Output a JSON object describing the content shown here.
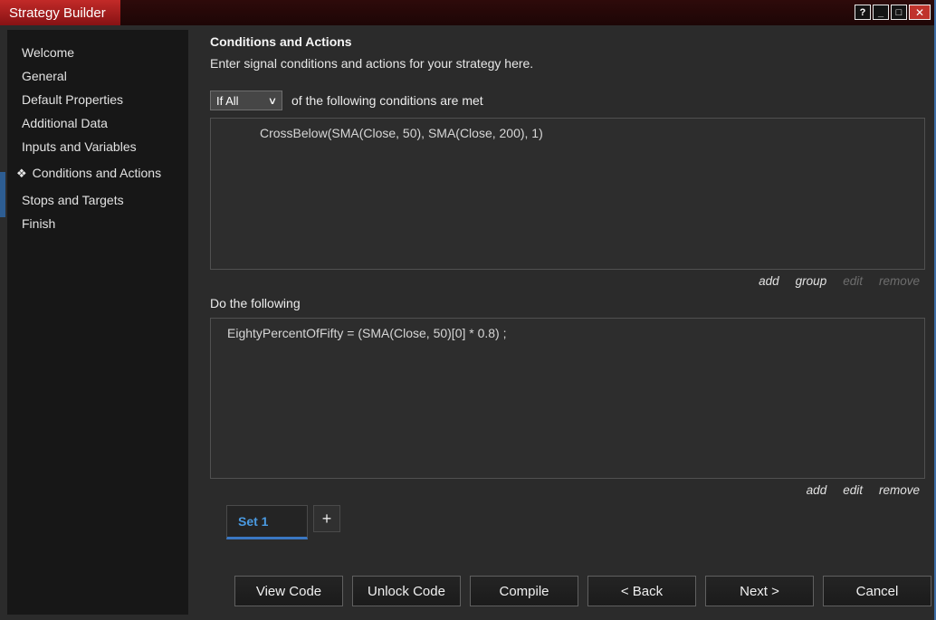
{
  "window": {
    "title": "Strategy Builder",
    "controls": {
      "help": "?",
      "minimize": "_",
      "maximize": "□",
      "close": "✕"
    }
  },
  "sidebar": {
    "items": [
      {
        "label": "Welcome"
      },
      {
        "label": "General"
      },
      {
        "label": "Default Properties"
      },
      {
        "label": "Additional Data"
      },
      {
        "label": "Inputs and Variables"
      },
      {
        "label": "Conditions and Actions",
        "active": true,
        "marker": "❖"
      },
      {
        "label": "Stops and Targets"
      },
      {
        "label": "Finish"
      }
    ]
  },
  "main": {
    "heading": "Conditions and Actions",
    "subheading": "Enter signal conditions and actions for your strategy here.",
    "conditions": {
      "combo_value": "If All",
      "after_combo": "of the following conditions are met",
      "rows": [
        "CrossBelow(SMA(Close, 50), SMA(Close, 200), 1)"
      ],
      "links": [
        {
          "label": "add",
          "disabled": false
        },
        {
          "label": "group",
          "disabled": false
        },
        {
          "label": "edit",
          "disabled": true
        },
        {
          "label": "remove",
          "disabled": true
        }
      ]
    },
    "actions": {
      "label": "Do the following",
      "rows": [
        "EightyPercentOfFifty = (SMA(Close, 50)[0] * 0.8) ;"
      ],
      "links": [
        {
          "label": "add",
          "disabled": false
        },
        {
          "label": "edit",
          "disabled": false
        },
        {
          "label": "remove",
          "disabled": false
        }
      ]
    },
    "tabs": [
      {
        "label": "Set 1",
        "active": true
      },
      {
        "label": "+"
      }
    ]
  },
  "footer": {
    "buttons": [
      "View Code",
      "Unlock Code",
      "Compile",
      "< Back",
      "Next >",
      "Cancel"
    ]
  },
  "colors": {
    "titlebar_red": "#b02025",
    "accent_blue": "#3d6da6",
    "tab_blue": "#4a9ae1"
  }
}
